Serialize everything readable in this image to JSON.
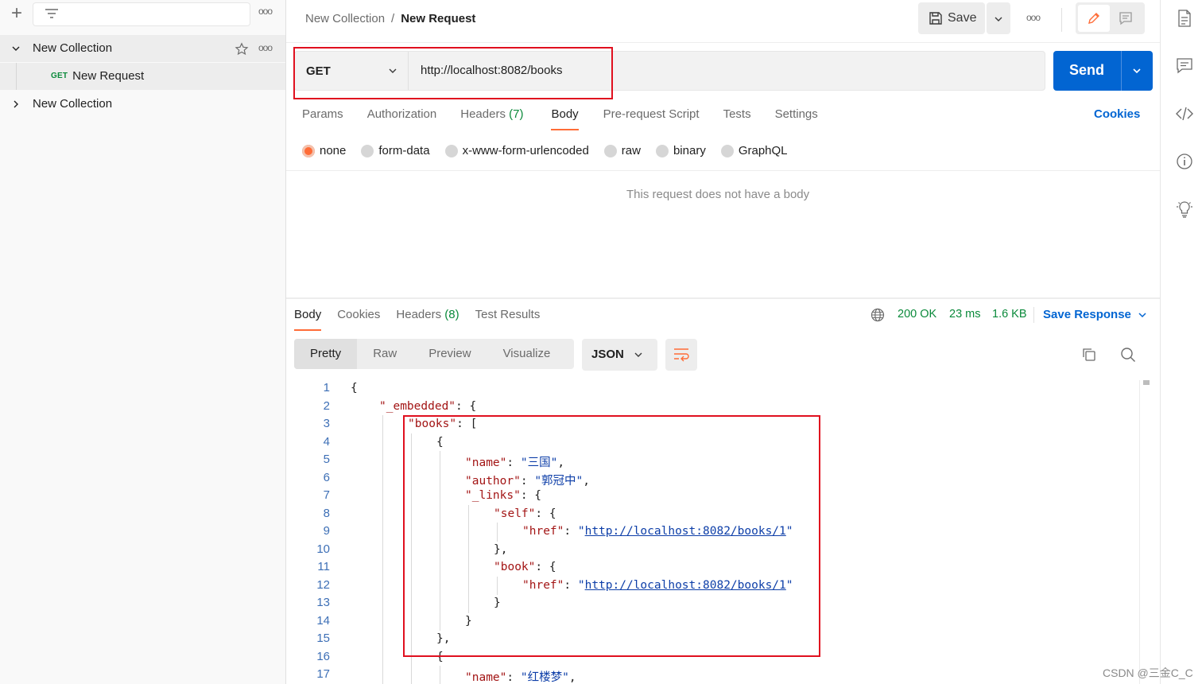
{
  "sidebar": {
    "add_label": "+",
    "more": "ooo",
    "collections": [
      {
        "name": "New Collection",
        "expanded": true,
        "items": [
          {
            "method": "GET",
            "name": "New Request"
          }
        ]
      },
      {
        "name": "New Collection",
        "expanded": false,
        "items": []
      }
    ]
  },
  "header": {
    "breadcrumb_parent": "New Collection",
    "breadcrumb_sep": "/",
    "breadcrumb_current": "New Request",
    "save_label": "Save",
    "more": "ooo"
  },
  "request": {
    "method": "GET",
    "url": "http://localhost:8082/books",
    "send_label": "Send",
    "tabs": [
      {
        "label": "Params"
      },
      {
        "label": "Authorization"
      },
      {
        "label": "Headers",
        "count": "(7)"
      },
      {
        "label": "Body",
        "active": true
      },
      {
        "label": "Pre-request Script"
      },
      {
        "label": "Tests"
      },
      {
        "label": "Settings"
      }
    ],
    "cookies_label": "Cookies",
    "body_types": [
      "none",
      "form-data",
      "x-www-form-urlencoded",
      "raw",
      "binary",
      "GraphQL"
    ],
    "body_selected": "none",
    "empty_message": "This request does not have a body"
  },
  "response": {
    "tabs": [
      {
        "label": "Body",
        "active": true
      },
      {
        "label": "Cookies"
      },
      {
        "label": "Headers",
        "count": "(8)"
      },
      {
        "label": "Test Results"
      }
    ],
    "status": "200 OK",
    "time": "23 ms",
    "size": "1.6 KB",
    "save_response_label": "Save Response",
    "view_modes": [
      "Pretty",
      "Raw",
      "Preview",
      "Visualize"
    ],
    "format": "JSON",
    "lines": [
      {
        "n": "1",
        "indent": 0,
        "parts": [
          [
            "p",
            "{"
          ]
        ]
      },
      {
        "n": "2",
        "indent": 1,
        "parts": [
          [
            "k",
            "\"_embedded\""
          ],
          [
            "p",
            ": {"
          ]
        ]
      },
      {
        "n": "3",
        "indent": 2,
        "parts": [
          [
            "k",
            "\"books\""
          ],
          [
            "p",
            ": ["
          ]
        ]
      },
      {
        "n": "4",
        "indent": 3,
        "parts": [
          [
            "p",
            "{"
          ]
        ]
      },
      {
        "n": "5",
        "indent": 4,
        "parts": [
          [
            "k",
            "\"name\""
          ],
          [
            "p",
            ": "
          ],
          [
            "s",
            "\"三国\""
          ],
          [
            "p",
            ","
          ]
        ]
      },
      {
        "n": "6",
        "indent": 4,
        "parts": [
          [
            "k",
            "\"author\""
          ],
          [
            "p",
            ": "
          ],
          [
            "s",
            "\"郭冠中\""
          ],
          [
            "p",
            ","
          ]
        ]
      },
      {
        "n": "7",
        "indent": 4,
        "parts": [
          [
            "k",
            "\"_links\""
          ],
          [
            "p",
            ": {"
          ]
        ]
      },
      {
        "n": "8",
        "indent": 5,
        "parts": [
          [
            "k",
            "\"self\""
          ],
          [
            "p",
            ": {"
          ]
        ]
      },
      {
        "n": "9",
        "indent": 6,
        "parts": [
          [
            "k",
            "\"href\""
          ],
          [
            "p",
            ": "
          ],
          [
            "s",
            "\""
          ],
          [
            "l",
            "http://localhost:8082/books/1"
          ],
          [
            "s",
            "\""
          ]
        ]
      },
      {
        "n": "10",
        "indent": 5,
        "parts": [
          [
            "p",
            "},"
          ]
        ]
      },
      {
        "n": "11",
        "indent": 5,
        "parts": [
          [
            "k",
            "\"book\""
          ],
          [
            "p",
            ": {"
          ]
        ]
      },
      {
        "n": "12",
        "indent": 6,
        "parts": [
          [
            "k",
            "\"href\""
          ],
          [
            "p",
            ": "
          ],
          [
            "s",
            "\""
          ],
          [
            "l",
            "http://localhost:8082/books/1"
          ],
          [
            "s",
            "\""
          ]
        ]
      },
      {
        "n": "13",
        "indent": 5,
        "parts": [
          [
            "p",
            "}"
          ]
        ]
      },
      {
        "n": "14",
        "indent": 4,
        "parts": [
          [
            "p",
            "}"
          ]
        ]
      },
      {
        "n": "15",
        "indent": 3,
        "parts": [
          [
            "p",
            "},"
          ]
        ]
      },
      {
        "n": "16",
        "indent": 3,
        "parts": [
          [
            "p",
            "{"
          ]
        ]
      },
      {
        "n": "17",
        "indent": 4,
        "parts": [
          [
            "k",
            "\"name\""
          ],
          [
            "p",
            ": "
          ],
          [
            "s",
            "\"红楼梦\""
          ],
          [
            "p",
            ","
          ]
        ]
      }
    ]
  },
  "watermark": "CSDN @三金C_C",
  "colors": {
    "accent": "#ff6c37",
    "primary": "#0265d2",
    "success": "#0b8a3b",
    "highlight": "#e0101f"
  }
}
